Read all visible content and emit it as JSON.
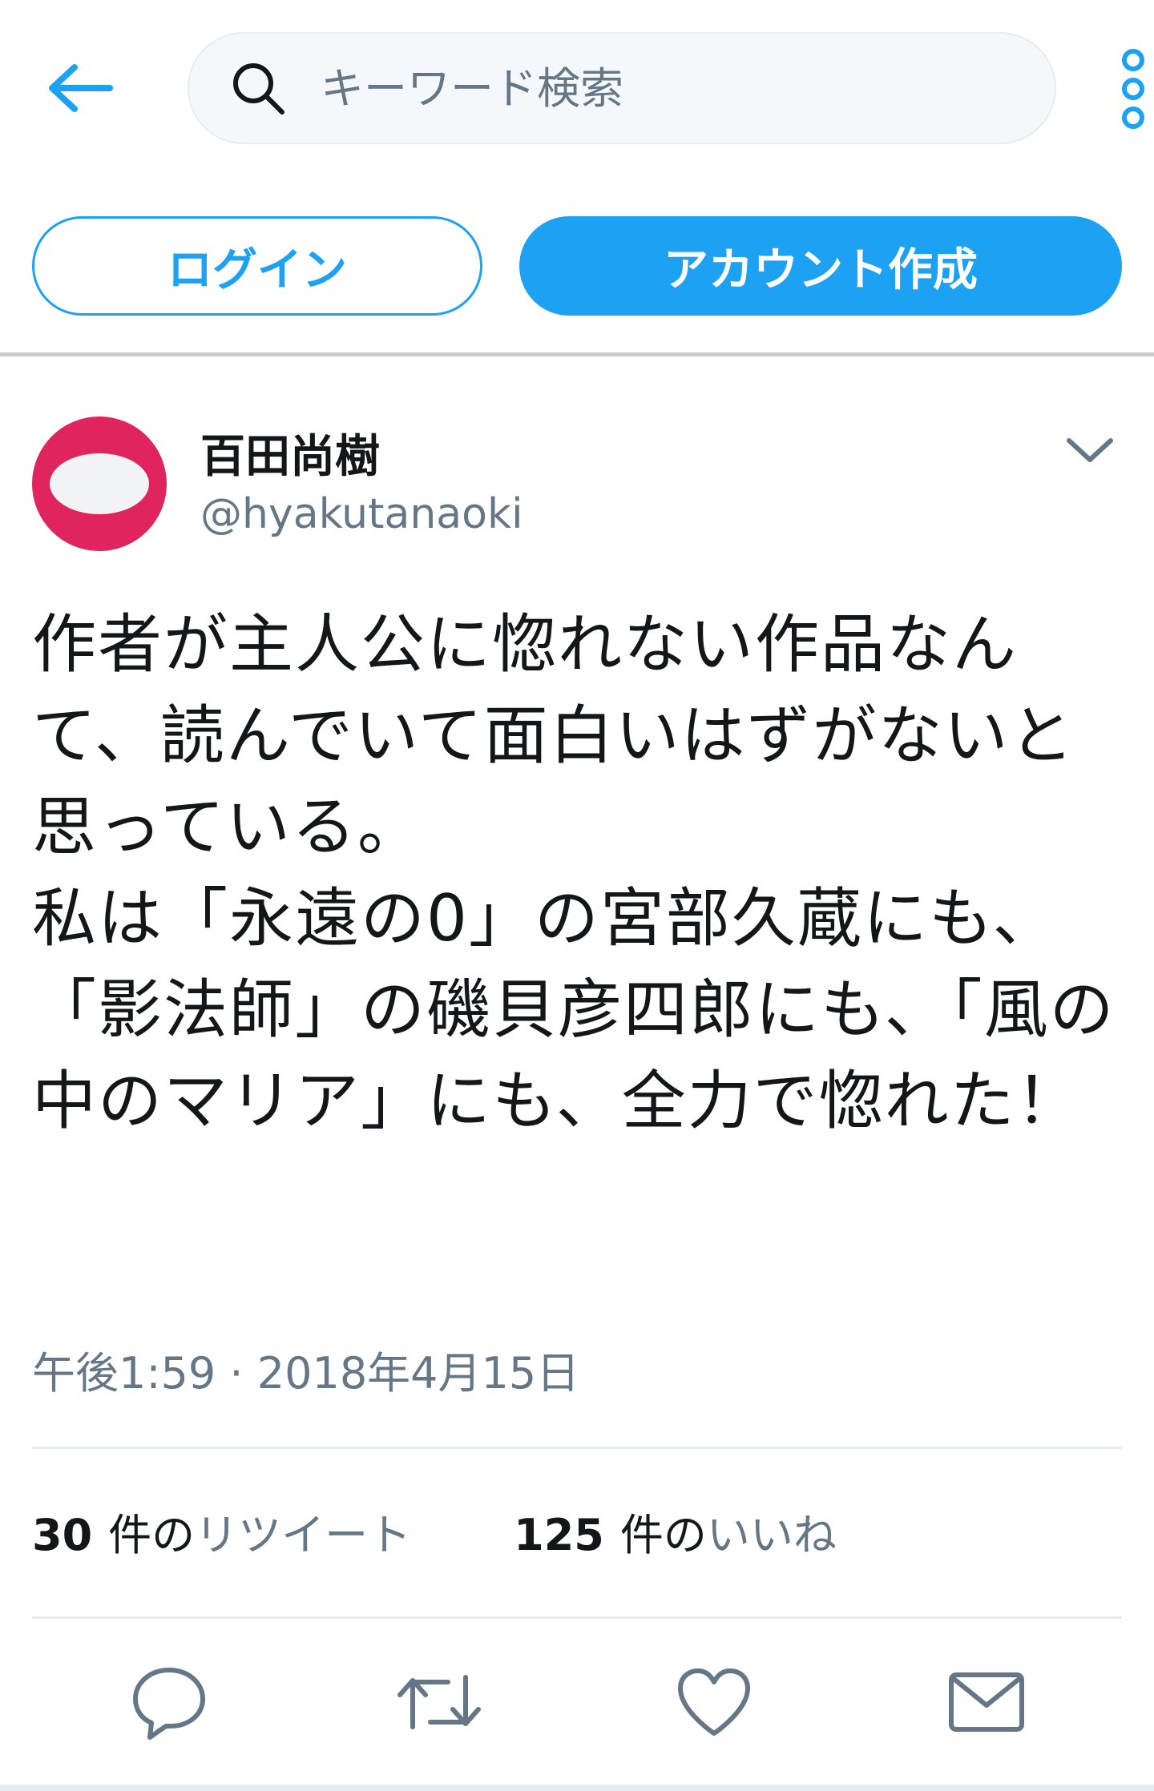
{
  "search": {
    "placeholder": "キーワード検索"
  },
  "auth": {
    "login_label": "ログイン",
    "signup_label": "アカウント作成"
  },
  "tweet": {
    "author_name": "百田尚樹",
    "author_handle": "@hyakutanaoki",
    "text": "作者が主人公に惚れない作品なんて、読んでいて面白いはずがないと思っている。\n私は「永遠の0」の宮部久蔵にも、「影法師」の磯貝彦四郎にも、「風の中のマリア」にも、全力で惚れた！",
    "timestamp": "午後1:59 · 2018年4月15日",
    "retweets": {
      "count": "30",
      "unit": "件の",
      "label": "リツイート"
    },
    "likes": {
      "count": "125",
      "unit": "件の",
      "label": "いいね"
    }
  },
  "colors": {
    "accent": "#1da1f2",
    "avatar_bg": "#e0245e",
    "muted_text": "#657786",
    "text": "#14171a"
  },
  "icons": {
    "back": "arrow-left-icon",
    "search": "search-icon",
    "more": "vertical-ellipsis-icon",
    "caret": "chevron-down-icon",
    "reply": "reply-icon",
    "retweet": "retweet-icon",
    "like": "heart-icon",
    "dm": "envelope-icon"
  }
}
